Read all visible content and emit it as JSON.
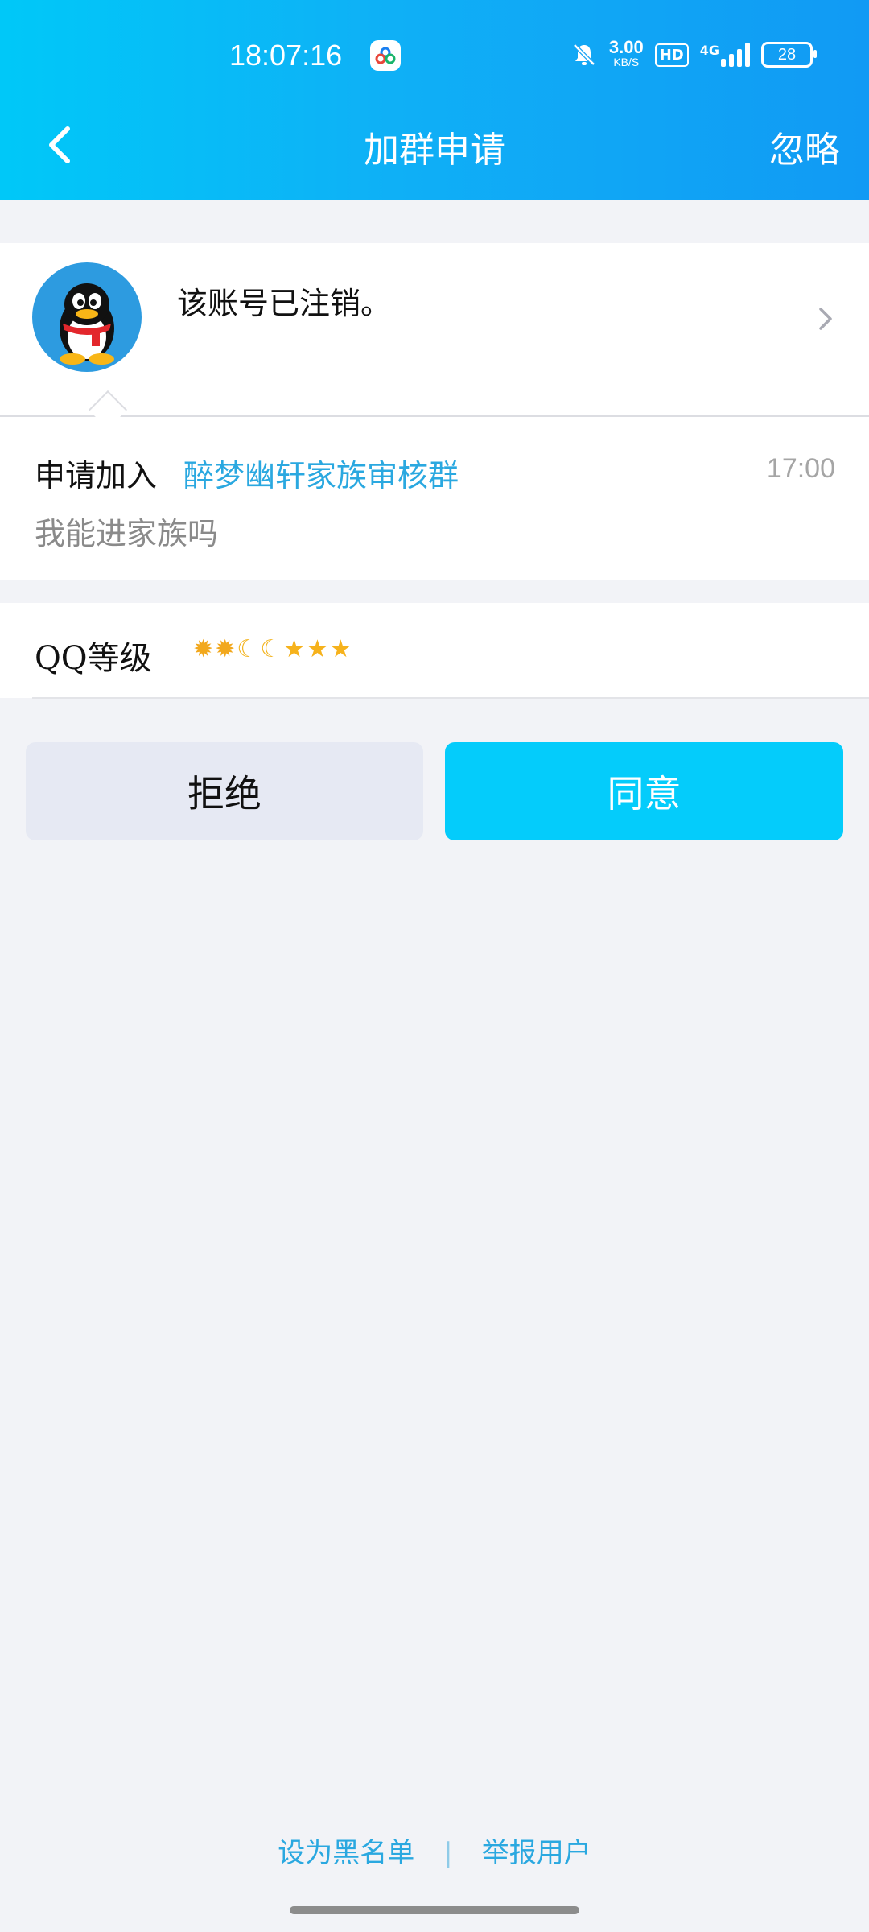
{
  "status_bar": {
    "time": "18:07:16",
    "net_speed_value": "3.00",
    "net_speed_unit": "KB/S",
    "hd": "HD",
    "network": "4G",
    "battery": "28"
  },
  "nav": {
    "title": "加群申请",
    "ignore_label": "忽略"
  },
  "applicant": {
    "name": "该账号已注销。"
  },
  "application": {
    "label": "申请加入",
    "group_name": "醉梦幽轩家族审核群",
    "time": "17:00",
    "message": "我能进家族吗"
  },
  "qq_level": {
    "label": "QQ等级",
    "icons": [
      "sun-icon",
      "sun-icon",
      "moon-icon",
      "moon-icon",
      "star-icon",
      "star-icon",
      "star-icon"
    ]
  },
  "actions": {
    "reject_label": "拒绝",
    "accept_label": "同意"
  },
  "footer": {
    "blacklist_label": "设为黑名单",
    "separator": "|",
    "report_label": "举报用户"
  },
  "colors": {
    "header_start": "#00c8f8",
    "header_end": "#119af4",
    "accent_link": "#2aa8e0",
    "accept_button": "#04ccfb",
    "reject_button": "#e6e9f3"
  }
}
